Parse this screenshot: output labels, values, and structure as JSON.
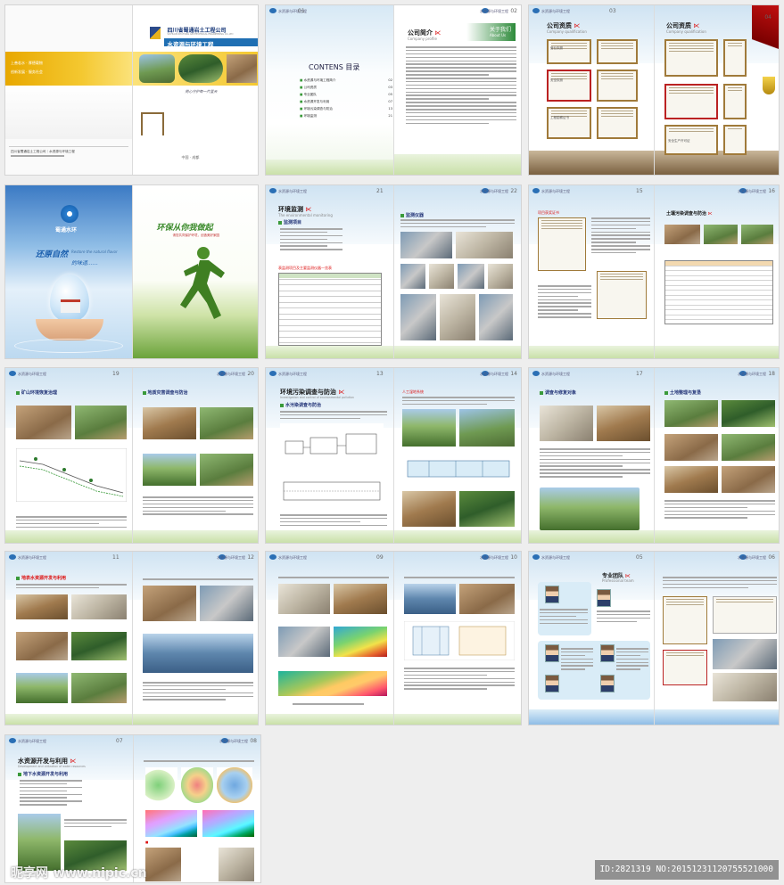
{
  "header": "水资源与环境工程",
  "cover": {
    "company": "四川省蜀通岩土工程公司",
    "company_en": "SICHUAN SHUTONG GEOTECHNICAL ENGINEERING CO.,LTD",
    "title": "水资源与环境工程",
    "title_en": "Water resources and environmental engineering",
    "tag1": "上善若水 · 厚德载物",
    "tag2": "创新发展 · 服务社会",
    "slogan": "用心守护每一片蓝天",
    "footer_text": "四川省蜀通岩土工程公司｜水资源与环境工程",
    "city": "中国 · 成都"
  },
  "toc": {
    "page": "01",
    "heading": "CONTENS 目录",
    "items": [
      {
        "label": "水资源与环境工程简介",
        "page": "02"
      },
      {
        "label": "公司资质",
        "page": "03"
      },
      {
        "label": "专业团队",
        "page": "05"
      },
      {
        "label": "水资源开发与利用",
        "page": "07"
      },
      {
        "label": "环境污染调查与防治",
        "page": "13"
      },
      {
        "label": "环境监测",
        "page": "21"
      }
    ]
  },
  "about": {
    "page": "02",
    "title": "公司简介",
    "subtitle": "Company profile",
    "banner": "关于我们",
    "banner_en": "About Us"
  },
  "qual": {
    "page_l": "03",
    "page_r": "04",
    "title": "公司资质",
    "subtitle": "Company qualification",
    "certs": [
      "营业执照",
      "安全执照",
      "工程勘察证书",
      "安全生产许可证"
    ]
  },
  "brand": {
    "logo_text": "蜀通水环",
    "slogan1": "还原自然",
    "slogan1_en": "Restore the natural flavor",
    "slogan2": "的味道……",
    "runner_title": "环保从你我做起",
    "runner_sub": "请您共同保护环境，创造美好家园"
  },
  "monitor": {
    "page_l": "21",
    "page_r": "22",
    "title": "环境监测",
    "subtitle": "The environmental monitoring",
    "sec1": "监测项目",
    "sec2": "监测仪器",
    "table_caption": "表监测项目及主要监测仪器一览表"
  },
  "soil": {
    "page_l": "15",
    "page_r": "16",
    "title": "土壤污染调查与防治",
    "sec1": "项目获奖证书"
  },
  "mine": {
    "page_l": "19",
    "page_r": "20",
    "sec1": "矿山环境恢复治理",
    "sec2": "地质灾害调查与防治"
  },
  "pollution": {
    "page_l": "13",
    "page_r": "14",
    "title": "环境污染调查与防治",
    "subtitle": "Investigation and control of environmental pollution",
    "sec1": "水污染调查与防治",
    "red1": "人工湿地系统"
  },
  "survey": {
    "page_l": "17",
    "page_r": "18",
    "sec1": "调查与修复对象",
    "sec2": "土地整理与复垦"
  },
  "water_dev": {
    "page_l": "11",
    "page_r": "12",
    "sec1": "地表水资源开发与利用"
  },
  "field": {
    "page_l": "09",
    "page_r": "10"
  },
  "team": {
    "page_l": "05",
    "page_r": "06",
    "title": "专业团队",
    "subtitle": "Professional team"
  },
  "dev": {
    "page_l": "07",
    "page_r": "08",
    "title": "水资源开发与利用",
    "subtitle": "Development and utilization of water resources",
    "sec1": "地下水资源开发与利用"
  },
  "watermark": {
    "site": "昵享网",
    "url": "www.nipic.cn",
    "id": "ID:2821319 NO:20151231120755521000"
  }
}
